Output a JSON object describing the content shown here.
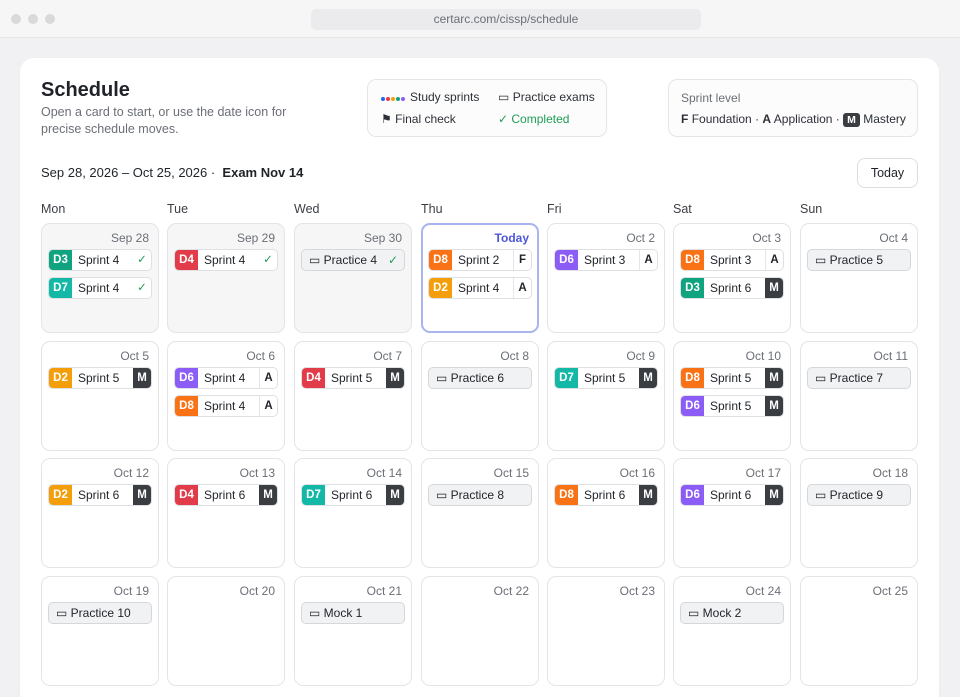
{
  "browser": {
    "url": "certarc.com/cissp/schedule"
  },
  "header": {
    "title": "Schedule",
    "subtitle": "Open a card to start, or use the date icon for precise schedule moves."
  },
  "legend": {
    "study_sprints": "Study sprints",
    "practice_exams": "Practice exams",
    "final_check": "Final check",
    "completed": "✓ Completed"
  },
  "sprint_level": {
    "title": "Sprint level",
    "f_key": "F",
    "f_label": "Foundation ·",
    "a_key": "A",
    "a_label": "Application ·",
    "m_key": "M",
    "m_label": "Mastery"
  },
  "range": {
    "text": "Sep 28, 2026 – Oct 25, 2026 ·",
    "exam": "Exam Nov 14"
  },
  "today_button": "Today",
  "weekdays": [
    "Mon",
    "Tue",
    "Wed",
    "Thu",
    "Fri",
    "Sat",
    "Sun"
  ],
  "colors": {
    "D1": "#2563eb",
    "D2": "#f59e0b",
    "D3": "#10a37f",
    "D4": "#e23b4a",
    "D5": "#0ea5e9",
    "D6": "#8b5cf6",
    "D7": "#14b8a6",
    "D8": "#f97316",
    "completed": "#1f9d55",
    "today": "#4e55d8"
  },
  "weeks": [
    [
      {
        "date": "Sep 28",
        "past": true,
        "events": [
          {
            "domain": "D3",
            "label": "Sprint 4",
            "tag": "✓"
          },
          {
            "domain": "D7",
            "label": "Sprint 4",
            "tag": "✓"
          }
        ]
      },
      {
        "date": "Sep 29",
        "past": true,
        "events": [
          {
            "domain": "D4",
            "label": "Sprint 4",
            "tag": "✓"
          }
        ]
      },
      {
        "date": "Sep 30",
        "past": true,
        "events": [
          {
            "practice": true,
            "label": "▭ Practice 4",
            "tag": "✓"
          }
        ]
      },
      {
        "date": "Today",
        "today": true,
        "events": [
          {
            "domain": "D8",
            "label": "Sprint 2",
            "tag": "F"
          },
          {
            "domain": "D2",
            "label": "Sprint 4",
            "tag": "A"
          }
        ]
      },
      {
        "date": "Oct 2",
        "events": [
          {
            "domain": "D6",
            "label": "Sprint 3",
            "tag": "A"
          }
        ]
      },
      {
        "date": "Oct 3",
        "events": [
          {
            "domain": "D8",
            "label": "Sprint 3",
            "tag": "A"
          },
          {
            "domain": "D3",
            "label": "Sprint 6",
            "tag": "M"
          }
        ]
      },
      {
        "date": "Oct 4",
        "events": [
          {
            "practice": true,
            "label": "▭ Practice 5"
          }
        ]
      }
    ],
    [
      {
        "date": "Oct 5",
        "events": [
          {
            "domain": "D2",
            "label": "Sprint 5",
            "tag": "M"
          }
        ]
      },
      {
        "date": "Oct 6",
        "events": [
          {
            "domain": "D6",
            "label": "Sprint 4",
            "tag": "A"
          },
          {
            "domain": "D8",
            "label": "Sprint 4",
            "tag": "A"
          }
        ]
      },
      {
        "date": "Oct 7",
        "events": [
          {
            "domain": "D4",
            "label": "Sprint 5",
            "tag": "M"
          }
        ]
      },
      {
        "date": "Oct 8",
        "events": [
          {
            "practice": true,
            "label": "▭ Practice 6"
          }
        ]
      },
      {
        "date": "Oct 9",
        "events": [
          {
            "domain": "D7",
            "label": "Sprint 5",
            "tag": "M"
          }
        ]
      },
      {
        "date": "Oct 10",
        "events": [
          {
            "domain": "D8",
            "label": "Sprint 5",
            "tag": "M"
          },
          {
            "domain": "D6",
            "label": "Sprint 5",
            "tag": "M"
          }
        ]
      },
      {
        "date": "Oct 11",
        "events": [
          {
            "practice": true,
            "label": "▭ Practice 7"
          }
        ]
      }
    ],
    [
      {
        "date": "Oct 12",
        "events": [
          {
            "domain": "D2",
            "label": "Sprint 6",
            "tag": "M"
          }
        ]
      },
      {
        "date": "Oct 13",
        "events": [
          {
            "domain": "D4",
            "label": "Sprint 6",
            "tag": "M"
          }
        ]
      },
      {
        "date": "Oct 14",
        "events": [
          {
            "domain": "D7",
            "label": "Sprint 6",
            "tag": "M"
          }
        ]
      },
      {
        "date": "Oct 15",
        "events": [
          {
            "practice": true,
            "label": "▭ Practice 8"
          }
        ]
      },
      {
        "date": "Oct 16",
        "events": [
          {
            "domain": "D8",
            "label": "Sprint 6",
            "tag": "M"
          }
        ]
      },
      {
        "date": "Oct 17",
        "events": [
          {
            "domain": "D6",
            "label": "Sprint 6",
            "tag": "M"
          }
        ]
      },
      {
        "date": "Oct 18",
        "events": [
          {
            "practice": true,
            "label": "▭ Practice 9"
          }
        ]
      }
    ],
    [
      {
        "date": "Oct 19",
        "events": [
          {
            "practice": true,
            "label": "▭ Practice 10"
          }
        ]
      },
      {
        "date": "Oct 20",
        "events": []
      },
      {
        "date": "Oct 21",
        "events": [
          {
            "practice": true,
            "label": "▭ Mock 1"
          }
        ]
      },
      {
        "date": "Oct 22",
        "events": []
      },
      {
        "date": "Oct 23",
        "events": []
      },
      {
        "date": "Oct 24",
        "events": [
          {
            "practice": true,
            "label": "▭ Mock 2"
          }
        ]
      },
      {
        "date": "Oct 25",
        "events": []
      }
    ]
  ]
}
